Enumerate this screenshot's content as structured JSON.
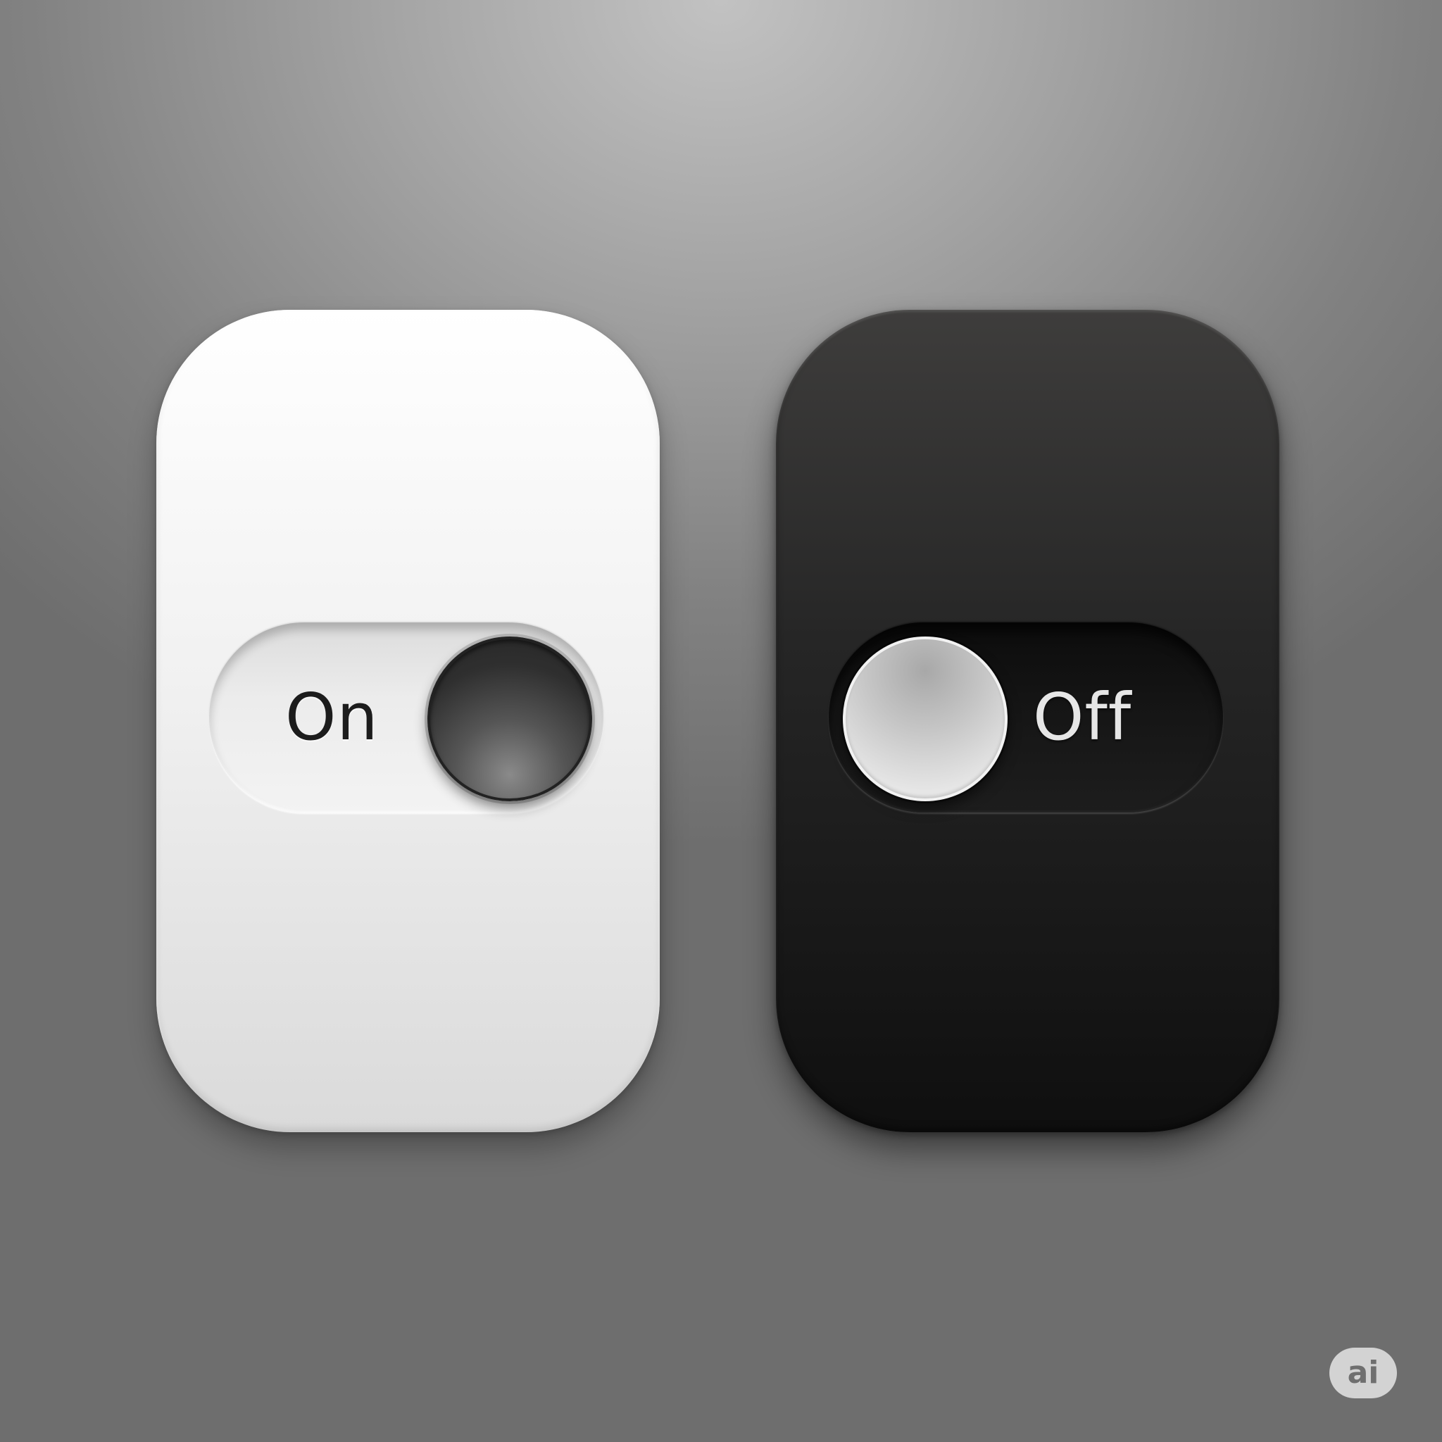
{
  "switches": [
    {
      "label": "On",
      "state": "on",
      "theme": "light"
    },
    {
      "label": "Off",
      "state": "off",
      "theme": "dark"
    }
  ],
  "badge": {
    "label": "ai"
  },
  "colors": {
    "background": "#9a9a9a",
    "light_card": "#f2f2f2",
    "dark_card": "#1f1f1f"
  }
}
